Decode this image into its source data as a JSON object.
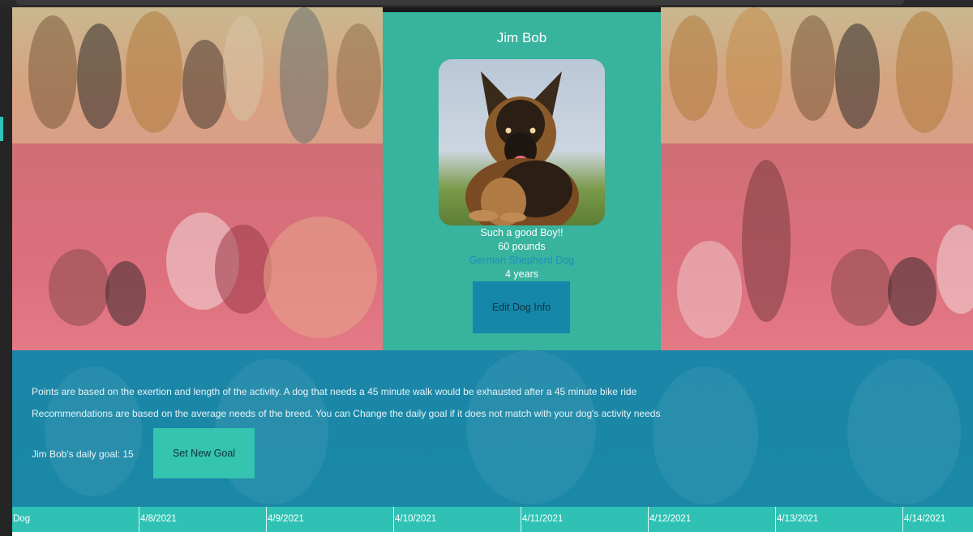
{
  "dog": {
    "name": "Jim Bob",
    "description": "Such a good Boy!!",
    "weight": "60 pounds",
    "breed": "German Shepherd Dog",
    "age": "4 years",
    "edit_label": "Edit Dog Info"
  },
  "info": {
    "points_note": "Points are based on the exertion and length of the activity. A dog that needs a 45 minute walk would be exhausted after a 45 minute bike ride",
    "recommend_note": "Recommendations are based on the average needs of the breed. You can Change the daily goal if it does not match with your dog's activity needs",
    "goal_label": "Jim Bob's daily goal: 15",
    "set_goal_label": "Set New Goal"
  },
  "table": {
    "headers": [
      "Dog",
      "4/8/2021",
      "4/9/2021",
      "4/10/2021",
      "4/11/2021",
      "4/12/2021",
      "4/13/2021",
      "4/14/2021"
    ]
  },
  "colors": {
    "teal": "#3ccdb4",
    "blue": "#1b86a8",
    "button_blue": "#1587a8",
    "breed_link": "#1b8fbf"
  }
}
